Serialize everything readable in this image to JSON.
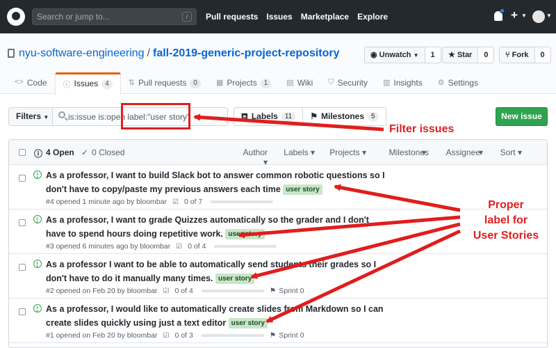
{
  "header": {
    "search_placeholder": "Search or jump to...",
    "search_shortcut": "/",
    "nav": [
      "Pull requests",
      "Issues",
      "Marketplace",
      "Explore"
    ]
  },
  "repo": {
    "owner": "nyu-software-engineering",
    "separator": "/",
    "name": "fall-2019-generic-project-repository",
    "unwatch_label": "Unwatch",
    "watch_count": "1",
    "star_label": "Star",
    "star_count": "0",
    "fork_label": "Fork",
    "fork_count": "0"
  },
  "tabs": [
    {
      "label": "Code",
      "icon": "code-icon"
    },
    {
      "label": "Issues",
      "count": "4",
      "icon": "issue-icon"
    },
    {
      "label": "Pull requests",
      "count": "0",
      "icon": "pull-request-icon"
    },
    {
      "label": "Projects",
      "count": "1",
      "icon": "project-icon"
    },
    {
      "label": "Wiki",
      "icon": "book-icon"
    },
    {
      "label": "Security",
      "icon": "shield-icon"
    },
    {
      "label": "Insights",
      "icon": "graph-icon"
    },
    {
      "label": "Settings",
      "icon": "gear-icon"
    }
  ],
  "filterbar": {
    "filters_label": "Filters",
    "query": "is:issue is:open label:\"user story\"",
    "labels_label": "Labels",
    "labels_count": "11",
    "milestones_label": "Milestones",
    "milestones_count": "5",
    "new_issue_label": "New issue"
  },
  "list_header": {
    "open_label": "4 Open",
    "closed_label": "0 Closed",
    "menus": [
      "Author",
      "Labels",
      "Projects",
      "Milestones",
      "Assignee",
      "Sort"
    ]
  },
  "issues": [
    {
      "title": "As a professor, I want to build Slack bot to answer common robotic questions so I don't have to copy/paste my previous answers each time",
      "label": "user story",
      "meta": "#4 opened 1 minute ago by bloombar",
      "tasks": "0 of 7",
      "progress": 0,
      "sprint": ""
    },
    {
      "title": "As a professor, I want to grade Quizzes automatically so the grader and I don't have to spend hours doing repetitive work.",
      "label": "user story",
      "meta": "#3 opened 6 minutes ago by bloombar",
      "tasks": "0 of 4",
      "progress": 0,
      "sprint": ""
    },
    {
      "title": "As a professor I want to be able to automatically send students their grades so I don't have to do it manually many times.",
      "label": "user story",
      "meta": "#2 opened on Feb 20 by bloombar",
      "tasks": "0 of 4",
      "progress": 0,
      "sprint": "Sprint 0"
    },
    {
      "title": "As a professor, I would like to automatically create slides from Markdown so I can create slides quickly using just a text editor",
      "label": "user story",
      "meta": "#1 opened on Feb 20 by bloombar",
      "tasks": "0 of 3",
      "progress": 0,
      "sprint": "Sprint 0"
    }
  ],
  "annotations": {
    "filter_note": "Filter issues",
    "label_note_line1": "Proper",
    "label_note_line2": "label for",
    "label_note_line3": "User Stories",
    "color": "#e11d1d"
  }
}
